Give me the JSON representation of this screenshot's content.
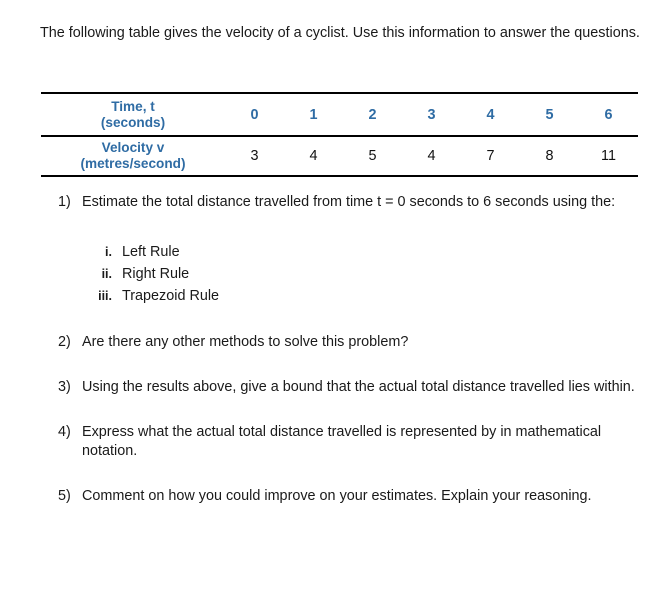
{
  "document": {
    "intro": "The following table gives the velocity of a cyclist. Use this information to answer the questions."
  },
  "colors": {
    "header_blue": "#2f6ca4",
    "body_text": "#1a1a1a",
    "rule": "#000000"
  },
  "table": {
    "rows": [
      {
        "label_line1": "Time, t",
        "label_line2": "(seconds)",
        "values": [
          "0",
          "1",
          "2",
          "3",
          "4",
          "5",
          "6"
        ]
      },
      {
        "label_line1": "Velocity v",
        "label_line2": "(metres/second)",
        "values": [
          "3",
          "4",
          "5",
          "4",
          "7",
          "8",
          "11"
        ]
      }
    ]
  },
  "chart_data": {
    "type": "table",
    "title": "Velocity of a cyclist",
    "xlabel": "Time, t (seconds)",
    "ylabel": "Velocity v (metres/second)",
    "categories": [
      0,
      1,
      2,
      3,
      4,
      5,
      6
    ],
    "series": [
      {
        "name": "Velocity v (metres/second)",
        "values": [
          3,
          4,
          5,
          4,
          7,
          8,
          11
        ]
      }
    ]
  },
  "questions": [
    {
      "marker": "1)",
      "text": "Estimate the total distance travelled from time t = 0 seconds to 6 seconds using the:",
      "sub": [
        {
          "marker": "i.",
          "text": "Left Rule"
        },
        {
          "marker": "ii.",
          "text": "Right Rule"
        },
        {
          "marker": "iii.",
          "text": "Trapezoid Rule"
        }
      ]
    },
    {
      "marker": "2)",
      "text": "Are there any other methods to solve this problem?"
    },
    {
      "marker": "3)",
      "text": "Using the results above, give a bound that the actual total distance travelled lies within."
    },
    {
      "marker": "4)",
      "text": "Express what the actual total distance travelled is represented by in mathematical notation."
    },
    {
      "marker": "5)",
      "text": "Comment on how you could improve on your estimates. Explain your reasoning."
    }
  ]
}
